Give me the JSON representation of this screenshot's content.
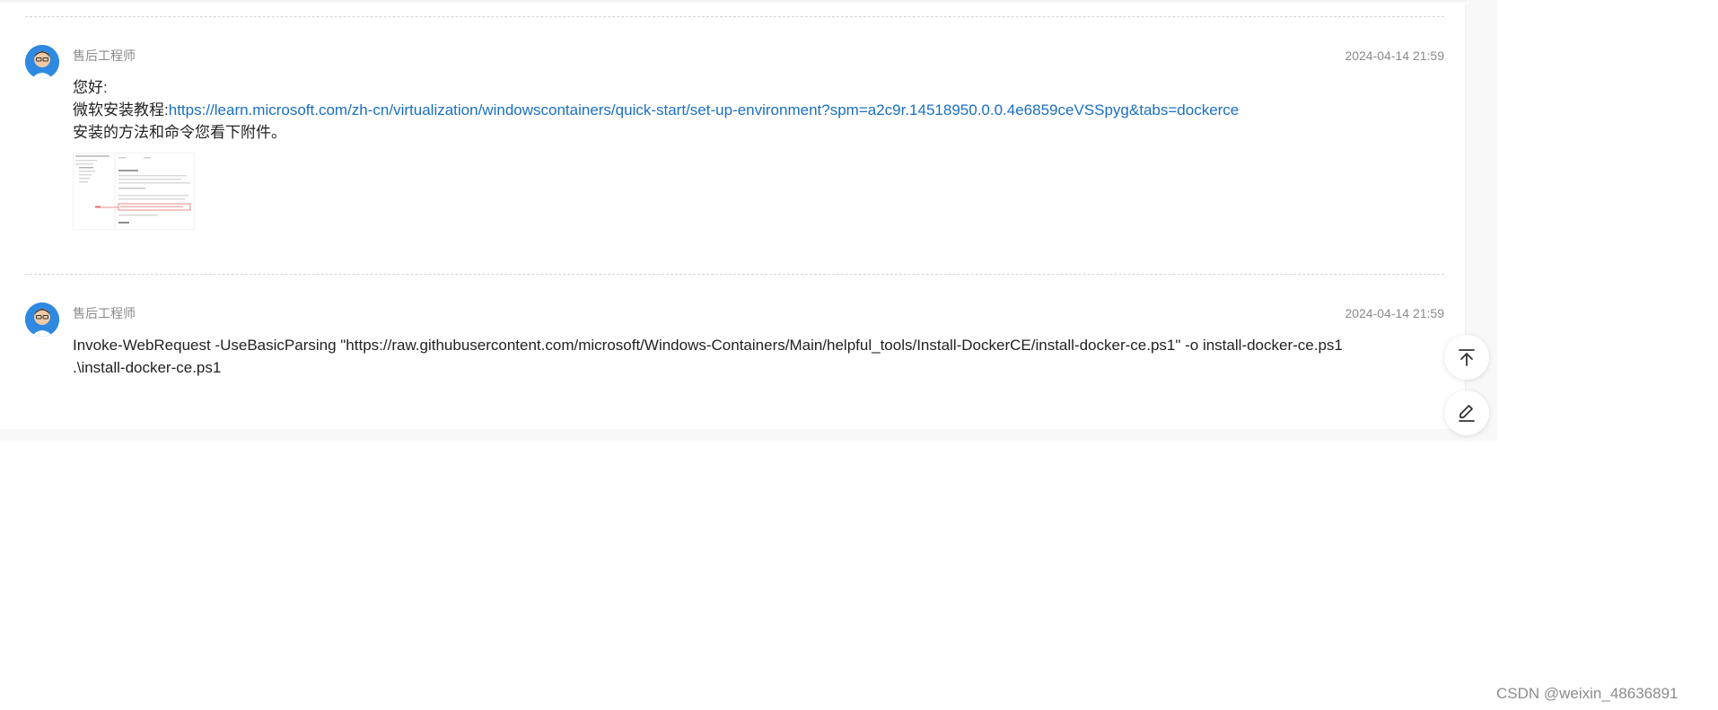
{
  "messages": [
    {
      "author": "售后工程师",
      "time": "2024-04-14 21:59",
      "greeting": "您好:",
      "tutorial_prefix": "微软安装教程:",
      "tutorial_link": "https://learn.microsoft.com/zh-cn/virtualization/windowscontainers/quick-start/set-up-environment?spm=a2c9r.14518950.0.0.4e6859ceVSSpyg&tabs=dockerce",
      "note": "安装的方法和命令您看下附件。"
    },
    {
      "author": "售后工程师",
      "time": "2024-04-14 21:59",
      "line1": "Invoke-WebRequest -UseBasicParsing \"https://raw.githubusercontent.com/microsoft/Windows-Containers/Main/helpful_tools/Install-DockerCE/install-docker-ce.ps1\" -o install-docker-ce.ps1",
      "line2": ".\\install-docker-ce.ps1"
    }
  ],
  "icons": {
    "back_to_top": "arrow-up-to-line-icon",
    "edit": "pencil-edit-icon"
  },
  "watermark": "CSDN @weixin_48636891",
  "colors": {
    "link": "#1a6fc4",
    "meta": "#8a8a8a",
    "text": "#222222",
    "avatar_bg": "#2f89e0"
  }
}
